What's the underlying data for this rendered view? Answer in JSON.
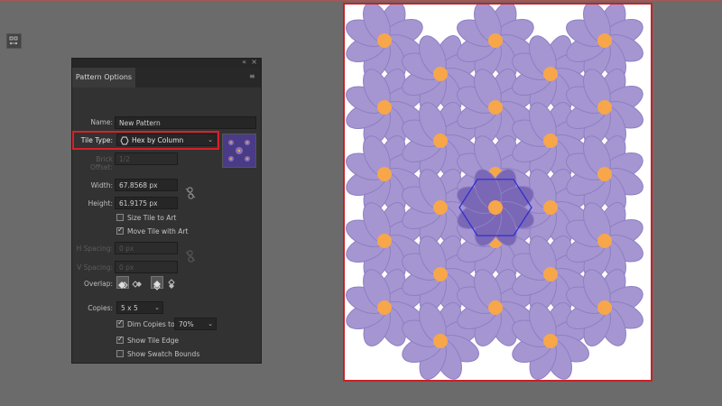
{
  "panel": {
    "title": "Pattern Options",
    "close_glyph": "×",
    "collapse_glyph": "«",
    "menu_glyph": "≡",
    "tile_tool_icon": "pattern-tile-tool-icon",
    "name_label": "Name:",
    "name_value": "New Pattern",
    "tile_type_label": "Tile Type:",
    "tile_type_value": "Hex by Column",
    "brick_offset_label": "Brick Offset:",
    "brick_offset_value": "1/2",
    "width_label": "Width:",
    "width_value": "67.8568 px",
    "height_label": "Height:",
    "height_value": "61.9175 px",
    "size_tile_to_art": "Size Tile to Art",
    "size_tile_to_art_checked": false,
    "move_tile_with_art": "Move Tile with Art",
    "move_tile_with_art_checked": true,
    "h_spacing_label": "H Spacing:",
    "h_spacing_value": "0 px",
    "v_spacing_label": "V Spacing:",
    "v_spacing_value": "0 px",
    "overlap_label": "Overlap:",
    "copies_label": "Copies:",
    "copies_value": "5 x 5",
    "dim_copies_label": "Dim Copies to:",
    "dim_copies_checked": true,
    "dim_copies_value": "70%",
    "show_tile_edge": "Show Tile Edge",
    "show_tile_edge_checked": true,
    "show_swatch_bounds": "Show Swatch Bounds",
    "show_swatch_bounds_checked": false
  },
  "colors": {
    "petal": "#a596d2",
    "petal_dark": "#8e7fc2",
    "center": "#f7a64a",
    "tile_petal": "#7a67b6",
    "tile_edge": "#2a2ad4",
    "highlight": "#d8202a"
  }
}
